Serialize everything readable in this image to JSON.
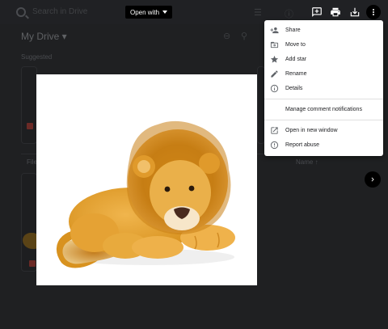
{
  "background": {
    "search_placeholder": "Search in Drive",
    "my_drive_label": "My Drive",
    "suggested_label": "Suggested",
    "files_col_label": "Files",
    "name_col_label": "Name"
  },
  "toolbar": {
    "open_with_label": "Open with",
    "icons": [
      "add-comment-icon",
      "print-icon",
      "download-icon",
      "more-vert-icon"
    ]
  },
  "preview": {
    "subject": "plush lion toy"
  },
  "menu": {
    "items": [
      {
        "label": "Share",
        "icon": "person-add-icon"
      },
      {
        "label": "Move to",
        "icon": "folder-move-icon"
      },
      {
        "label": "Add star",
        "icon": "star-icon"
      },
      {
        "label": "Rename",
        "icon": "pencil-icon"
      },
      {
        "label": "Details",
        "icon": "info-icon"
      },
      {
        "label": "Manage comment notifications",
        "icon": ""
      },
      {
        "label": "Open in new window",
        "icon": "open-in-new-icon"
      },
      {
        "label": "Report abuse",
        "icon": "report-icon"
      }
    ]
  },
  "colors": {
    "backdrop": "#1f2022",
    "menu_bg": "#ffffff",
    "toolbar_button_bg": "#000000",
    "icon_gray": "#5f6368"
  }
}
